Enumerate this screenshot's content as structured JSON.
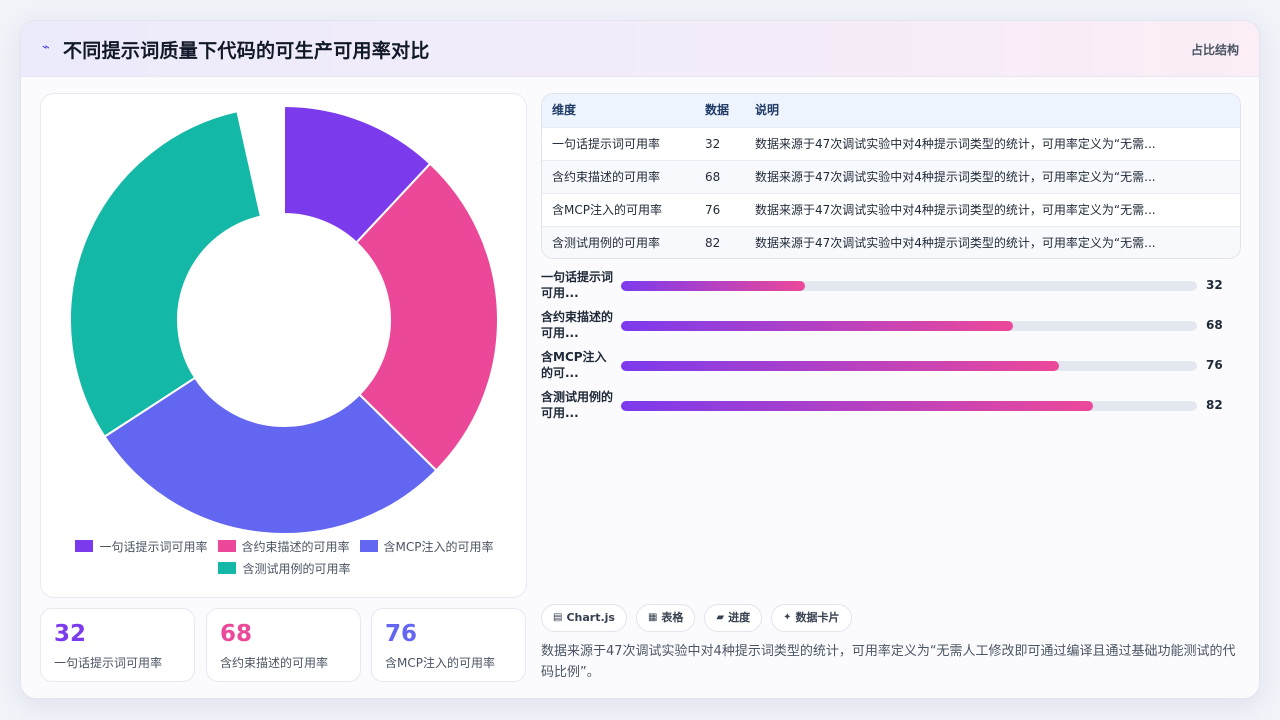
{
  "header": {
    "icon": "sparkle-icon",
    "title": "不同提示词质量下代码的可生产可用率对比",
    "kind": "占比结构"
  },
  "chart_data": {
    "type": "pie",
    "donut": true,
    "categories": [
      "一句话提示词可用率",
      "含约束描述的可用率",
      "含MCP注入的可用率",
      "含测试用例的可用率"
    ],
    "values": [
      32,
      68,
      76,
      82
    ],
    "colors": [
      "#7c3aed",
      "#ec4899",
      "#6366f1",
      "#14b8a6"
    ],
    "legend": "bottom"
  },
  "stats": [
    {
      "value": "32",
      "label": "一句话提示词可用率",
      "color": "#7c3aed"
    },
    {
      "value": "68",
      "label": "含约束描述的可用率",
      "color": "#ec4899"
    },
    {
      "value": "76",
      "label": "含MCP注入的可用率",
      "color": "#6366f1"
    }
  ],
  "table": {
    "headers": [
      "维度",
      "数据",
      "说明"
    ],
    "rows": [
      {
        "name": "一句话提示词可用率",
        "value": "32",
        "desc": "数据来源于47次调试实验中对4种提示词类型的统计，可用率定义为“无需..."
      },
      {
        "name": "含约束描述的可用率",
        "value": "68",
        "desc": "数据来源于47次调试实验中对4种提示词类型的统计，可用率定义为“无需..."
      },
      {
        "name": "含MCP注入的可用率",
        "value": "76",
        "desc": "数据来源于47次调试实验中对4种提示词类型的统计，可用率定义为“无需..."
      },
      {
        "name": "含测试用例的可用率",
        "value": "82",
        "desc": "数据来源于47次调试实验中对4种提示词类型的统计，可用率定义为“无需..."
      }
    ]
  },
  "bars": [
    {
      "label": "一句话提示词可用...",
      "value": 32,
      "display": "32"
    },
    {
      "label": "含约束描述的可用...",
      "value": 68,
      "display": "68"
    },
    {
      "label": "含MCP注入的可...",
      "value": 76,
      "display": "76"
    },
    {
      "label": "含测试用例的可用...",
      "value": 82,
      "display": "82"
    }
  ],
  "chips": [
    {
      "icon": "chart-icon",
      "glyph": "▤",
      "label": "Chart.js"
    },
    {
      "icon": "table-icon",
      "glyph": "▦",
      "label": "表格"
    },
    {
      "icon": "progress-icon",
      "glyph": "▰",
      "label": "进度"
    },
    {
      "icon": "sparkle-icon",
      "glyph": "✦",
      "label": "数据卡片"
    }
  ],
  "note": "数据来源于47次调试实验中对4种提示词类型的统计，可用率定义为“无需人工修改即可通过编译且通过基础功能测试的代码比例”。"
}
